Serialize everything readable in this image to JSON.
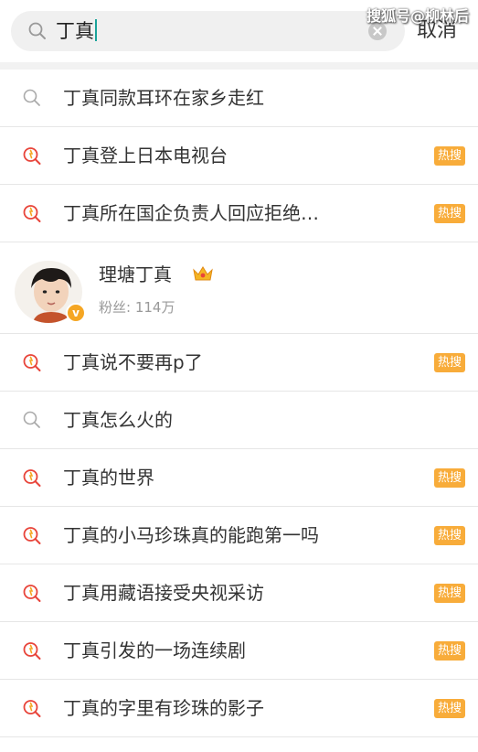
{
  "header": {
    "watermark": "搜狐号@柳林后",
    "search_query": "丁真",
    "cancel_label": "取消"
  },
  "suggestions_top": [
    {
      "text": "丁真同款耳环在家乡走红",
      "type": "normal"
    },
    {
      "text": "丁真登上日本电视台",
      "type": "hot",
      "badge": "热搜"
    },
    {
      "text": "丁真所在国企负责人回应拒绝…",
      "type": "hot",
      "badge": "热搜"
    }
  ],
  "user": {
    "name": "理塘丁真",
    "fans": "粉丝: 114万",
    "verified_badge": "v"
  },
  "suggestions_bottom": [
    {
      "text": "丁真说不要再p了",
      "type": "hot",
      "badge": "热搜"
    },
    {
      "text": "丁真怎么火的",
      "type": "normal"
    },
    {
      "text": "丁真的世界",
      "type": "hot",
      "badge": "热搜"
    },
    {
      "text": "丁真的小马珍珠真的能跑第一吗",
      "type": "hot",
      "badge": "热搜"
    },
    {
      "text": "丁真用藏语接受央视采访",
      "type": "hot",
      "badge": "热搜"
    },
    {
      "text": "丁真引发的一场连续剧",
      "type": "hot",
      "badge": "热搜"
    },
    {
      "text": "丁真的字里有珍珠的影子",
      "type": "hot",
      "badge": "热搜"
    }
  ],
  "colors": {
    "hot_badge": "#f8ac3a",
    "hot_icon_ring": "#e8443a",
    "hot_icon_spark": "#f5a623",
    "cursor": "#1aa39a"
  }
}
